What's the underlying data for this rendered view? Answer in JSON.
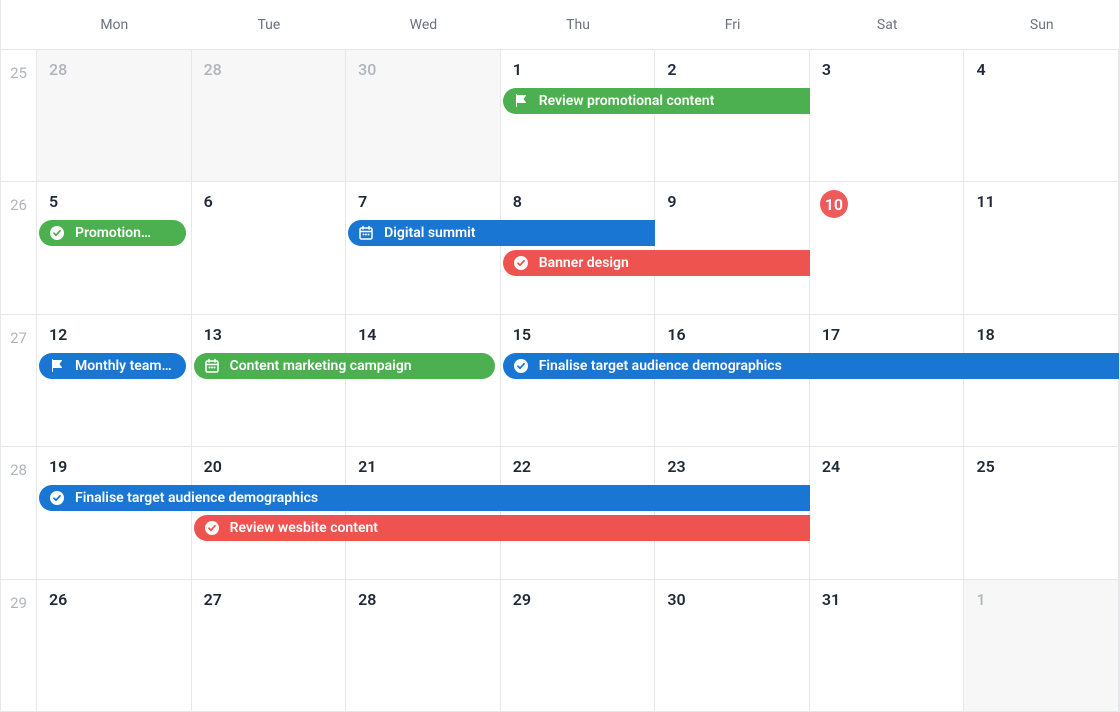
{
  "dayHeaders": [
    "Mon",
    "Tue",
    "Wed",
    "Thu",
    "Fri",
    "Sat",
    "Sun"
  ],
  "weeks": [
    {
      "num": "25",
      "days": [
        {
          "n": "28",
          "muted": true,
          "dim": true
        },
        {
          "n": "28",
          "muted": true,
          "dim": true
        },
        {
          "n": "30",
          "muted": true,
          "dim": true
        },
        {
          "n": "1"
        },
        {
          "n": "2"
        },
        {
          "n": "3"
        },
        {
          "n": "4"
        }
      ]
    },
    {
      "num": "26",
      "days": [
        {
          "n": "5"
        },
        {
          "n": "6"
        },
        {
          "n": "7"
        },
        {
          "n": "8"
        },
        {
          "n": "9"
        },
        {
          "n": "10",
          "today": true
        },
        {
          "n": "11"
        }
      ]
    },
    {
      "num": "27",
      "days": [
        {
          "n": "12"
        },
        {
          "n": "13"
        },
        {
          "n": "14"
        },
        {
          "n": "15"
        },
        {
          "n": "16"
        },
        {
          "n": "17"
        },
        {
          "n": "18"
        }
      ]
    },
    {
      "num": "28",
      "days": [
        {
          "n": "19"
        },
        {
          "n": "20"
        },
        {
          "n": "21"
        },
        {
          "n": "22"
        },
        {
          "n": "23"
        },
        {
          "n": "24"
        },
        {
          "n": "25"
        }
      ]
    },
    {
      "num": "29",
      "days": [
        {
          "n": "26"
        },
        {
          "n": "27"
        },
        {
          "n": "28"
        },
        {
          "n": "29"
        },
        {
          "n": "30"
        },
        {
          "n": "31"
        },
        {
          "n": "1",
          "muted": true,
          "dim": true
        }
      ]
    }
  ],
  "events": [
    {
      "week": 0,
      "startCol": 3,
      "endCol": 5,
      "row": 0,
      "color": "green",
      "icon": "flag",
      "endFlat": true,
      "label": "Review promotional content"
    },
    {
      "week": 1,
      "startCol": 0,
      "endCol": 1,
      "row": 0,
      "color": "green",
      "icon": "check",
      "label": "Promotion…"
    },
    {
      "week": 1,
      "startCol": 2,
      "endCol": 4,
      "row": 0,
      "color": "blue",
      "icon": "calendar",
      "endFlat": true,
      "label": "Digital summit"
    },
    {
      "week": 1,
      "startCol": 3,
      "endCol": 5,
      "row": 1,
      "color": "red",
      "icon": "check",
      "endFlat": true,
      "label": "Banner design"
    },
    {
      "week": 2,
      "startCol": 0,
      "endCol": 1,
      "row": 0,
      "color": "blue",
      "icon": "flag",
      "label": "Monthly team…"
    },
    {
      "week": 2,
      "startCol": 1,
      "endCol": 3,
      "row": 0,
      "color": "green",
      "icon": "calendar",
      "label": "Content marketing campaign"
    },
    {
      "week": 2,
      "startCol": 3,
      "endCol": 7,
      "row": 0,
      "color": "blue",
      "icon": "check",
      "endFlat": true,
      "label": "Finalise target audience demographics"
    },
    {
      "week": 3,
      "startCol": 0,
      "endCol": 5,
      "row": 0,
      "color": "blue",
      "icon": "check",
      "endFlat": true,
      "label": "Finalise target audience demographics"
    },
    {
      "week": 3,
      "startCol": 1,
      "endCol": 5,
      "row": 1,
      "color": "red",
      "icon": "check",
      "endFlat": true,
      "label": "Review wesbite content"
    }
  ],
  "colors": {
    "green": "#4caf50",
    "blue": "#1976d2",
    "red": "#ef5350",
    "today": "#ef5b5b"
  }
}
